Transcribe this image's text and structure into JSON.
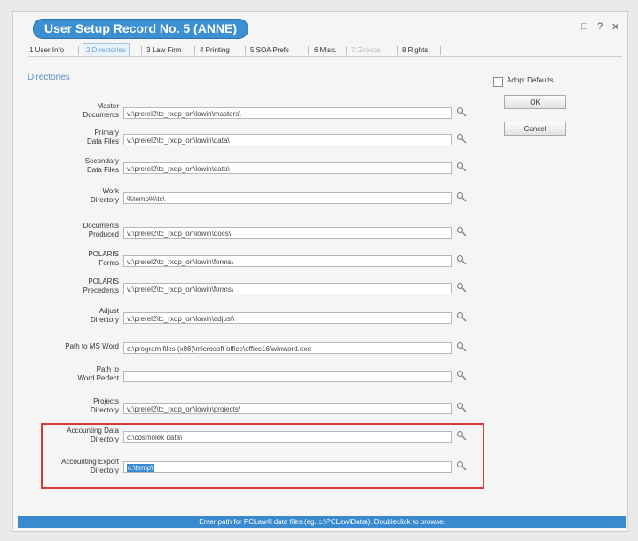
{
  "window": {
    "title": "User Setup Record No. 5 (ANNE)",
    "controls": [
      "□",
      "?",
      "✕"
    ]
  },
  "tabs": [
    {
      "label": "1 User Info"
    },
    {
      "label": "2 Directories"
    },
    {
      "label": "3 Law Firm"
    },
    {
      "label": "4 Printing"
    },
    {
      "label": "5 SOA Prefs"
    },
    {
      "label": "6 Misc."
    },
    {
      "label": "7 Groups"
    },
    {
      "label": "8 Rights"
    }
  ],
  "section": {
    "title": "Directories"
  },
  "rows": [
    {
      "label1": "Master",
      "label2": "Documents",
      "value": "v:\\prerel2\\tc_rxdp_on\\lowin\\masters\\"
    },
    {
      "label1": "Primary",
      "label2": "Data Files",
      "value": "v:\\prerel2\\tc_rxdp_on\\lowin\\data\\"
    },
    {
      "label1": "Secondary",
      "label2": "Data Files",
      "value": "v:\\prerel2\\tc_rxdp_on\\lowin\\data\\"
    },
    {
      "label1": "Work",
      "label2": "Directory",
      "value": "%temp%\\tc\\"
    },
    {
      "label1": "Documents",
      "label2": "Produced",
      "value": "v:\\prerel2\\tc_rxdp_on\\lowin\\docs\\"
    },
    {
      "label1": "POLARIS",
      "label2": "Forms",
      "value": "v:\\prerel2\\tc_rxdp_on\\lowin\\forms\\"
    },
    {
      "label1": "POLARIS",
      "label2": "Precedents",
      "value": "v:\\prerel2\\tc_rxdp_on\\lowin\\forms\\"
    },
    {
      "label1": "Adjust",
      "label2": "Directory",
      "value": "v:\\prerel2\\tc_rxdp_on\\lowin\\adjust\\"
    },
    {
      "label1": "Path to MS Word",
      "label2": "",
      "value": "c:\\program files (x86)\\microsoft office\\office16\\winword.exe"
    },
    {
      "label1": "Path to",
      "label2": "Word Perfect",
      "value": ""
    },
    {
      "label1": "Projects",
      "label2": "Directory",
      "value": "v:\\prerel2\\tc_rxdp_on\\lowin\\projects\\"
    },
    {
      "label1": "Accounting Data",
      "label2": "Directory",
      "value": "c:\\cosmolex data\\"
    },
    {
      "label1": "Accounting Export",
      "label2": "Directory",
      "value": "c:\\temp\\"
    }
  ],
  "side": {
    "adopt_defaults": "Adopt Defaults",
    "ok": "OK",
    "cancel": "Cancel"
  },
  "status_bar": {
    "text": "Enter path for PCLaw® data files (eg. c:\\PCLaw\\Data\\). Doubleclick to browse."
  }
}
